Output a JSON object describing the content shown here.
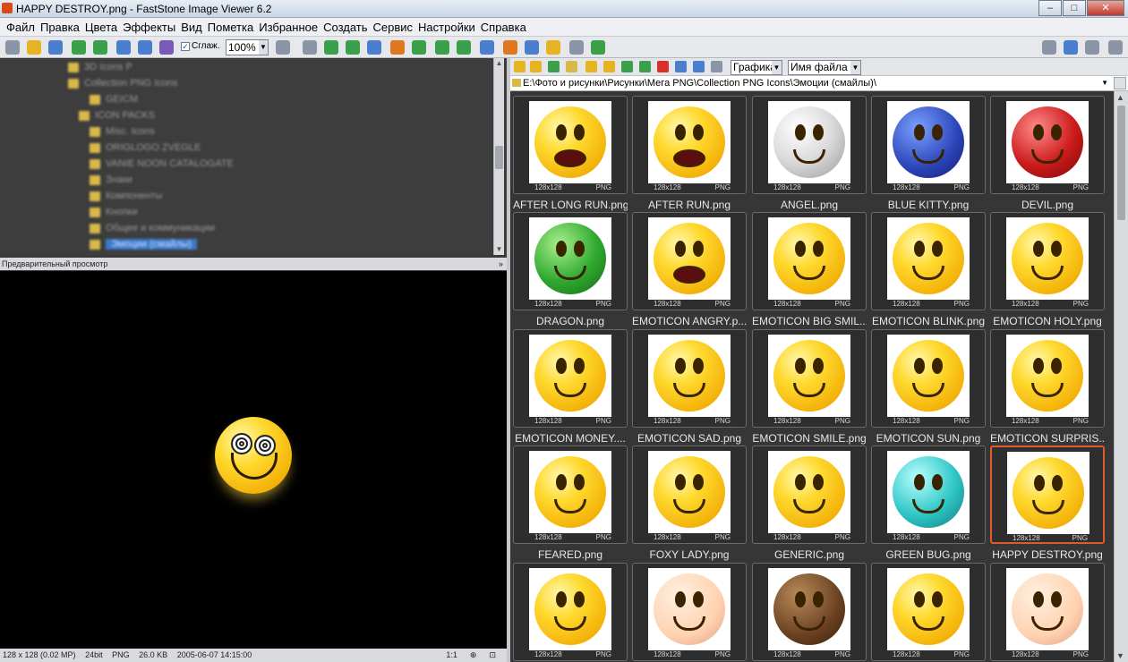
{
  "window": {
    "title": "HAPPY DESTROY.png  -  FastStone Image Viewer 6.2",
    "minimize": "‒",
    "maximize": "□",
    "close": "✕"
  },
  "menu": [
    "Файл",
    "Правка",
    "Цвета",
    "Эффекты",
    "Вид",
    "Пометка",
    "Избранное",
    "Создать",
    "Сервис",
    "Настройки",
    "Справка"
  ],
  "toolbar": {
    "smooth_label": "Сглаж.",
    "smooth_checked": "✓",
    "zoom": "100%"
  },
  "tree": {
    "items": [
      "3D Icons P",
      "Collection PNG Icons",
      "GEICM",
      "ICON PACKS",
      "Misc. Icons",
      "ORIGLOGO ZVEGLE",
      "VANIE NOON CATALOGATE",
      "Знаки",
      "Компоненты",
      "Кнопки",
      "Общее и коммуникации",
      "Эмоции (смайлы)"
    ]
  },
  "preview": {
    "header": "Предварительный просмотр"
  },
  "status": {
    "dimensions": "128 x 128 (0.02 MP)",
    "bitdepth": "24bit",
    "format": "PNG",
    "size": "26.0 KB",
    "datetime": "2005-06-07 14:15:00",
    "ratio": "1:1"
  },
  "browser": {
    "sort_by": "Графика",
    "sort_field": "Имя файла",
    "path": "E:\\Фото и рисунки\\Рисунки\\Мега  PNG\\Collection PNG Icons\\Эмоции (смайлы)\\"
  },
  "thumbnails": [
    {
      "name": "AFTER LONG RUN.png",
      "dims": "128x128",
      "fmt": "PNG",
      "color": "yellow"
    },
    {
      "name": "AFTER RUN.png",
      "dims": "128x128",
      "fmt": "PNG",
      "color": "yellow"
    },
    {
      "name": "ANGEL.png",
      "dims": "128x128",
      "fmt": "PNG",
      "color": "grey"
    },
    {
      "name": "BLUE KITTY.png",
      "dims": "128x128",
      "fmt": "PNG",
      "color": "blue"
    },
    {
      "name": "DEVIL.png",
      "dims": "128x128",
      "fmt": "PNG",
      "color": "red"
    },
    {
      "name": "DRAGON.png",
      "dims": "128x128",
      "fmt": "PNG",
      "color": "green"
    },
    {
      "name": "EMOTICON ANGRY.p...",
      "dims": "128x128",
      "fmt": "PNG",
      "color": "yellow"
    },
    {
      "name": "EMOTICON BIG SMIL...",
      "dims": "128x128",
      "fmt": "PNG",
      "color": "yellow"
    },
    {
      "name": "EMOTICON BLINK.png",
      "dims": "128x128",
      "fmt": "PNG",
      "color": "yellow"
    },
    {
      "name": "EMOTICON HOLY.png",
      "dims": "128x128",
      "fmt": "PNG",
      "color": "yellow"
    },
    {
      "name": "EMOTICON MONEY....",
      "dims": "128x128",
      "fmt": "PNG",
      "color": "yellow"
    },
    {
      "name": "EMOTICON SAD.png",
      "dims": "128x128",
      "fmt": "PNG",
      "color": "yellow"
    },
    {
      "name": "EMOTICON SMILE.png",
      "dims": "128x128",
      "fmt": "PNG",
      "color": "yellow"
    },
    {
      "name": "EMOTICON SUN.png",
      "dims": "128x128",
      "fmt": "PNG",
      "color": "yellow"
    },
    {
      "name": "EMOTICON SURPRIS...",
      "dims": "128x128",
      "fmt": "PNG",
      "color": "yellow"
    },
    {
      "name": "FEARED.png",
      "dims": "128x128",
      "fmt": "PNG",
      "color": "yellow"
    },
    {
      "name": "FOXY LADY.png",
      "dims": "128x128",
      "fmt": "PNG",
      "color": "yellow"
    },
    {
      "name": "GENERIC.png",
      "dims": "128x128",
      "fmt": "PNG",
      "color": "yellow"
    },
    {
      "name": "GREEN BUG.png",
      "dims": "128x128",
      "fmt": "PNG",
      "color": "cyan"
    },
    {
      "name": "HAPPY DESTROY.png",
      "dims": "128x128",
      "fmt": "PNG",
      "color": "yellow",
      "selected": true
    },
    {
      "name": "",
      "dims": "128x128",
      "fmt": "PNG",
      "color": "yellow"
    },
    {
      "name": "",
      "dims": "128x128",
      "fmt": "PNG",
      "color": "peach"
    },
    {
      "name": "",
      "dims": "128x128",
      "fmt": "PNG",
      "color": "brown"
    },
    {
      "name": "",
      "dims": "128x128",
      "fmt": "PNG",
      "color": "yellow"
    },
    {
      "name": "",
      "dims": "128x128",
      "fmt": "PNG",
      "color": "peach"
    }
  ],
  "colors": {
    "selection": "#e05a2a",
    "thumb_bg": "#363636",
    "preview_bg": "#000000"
  }
}
